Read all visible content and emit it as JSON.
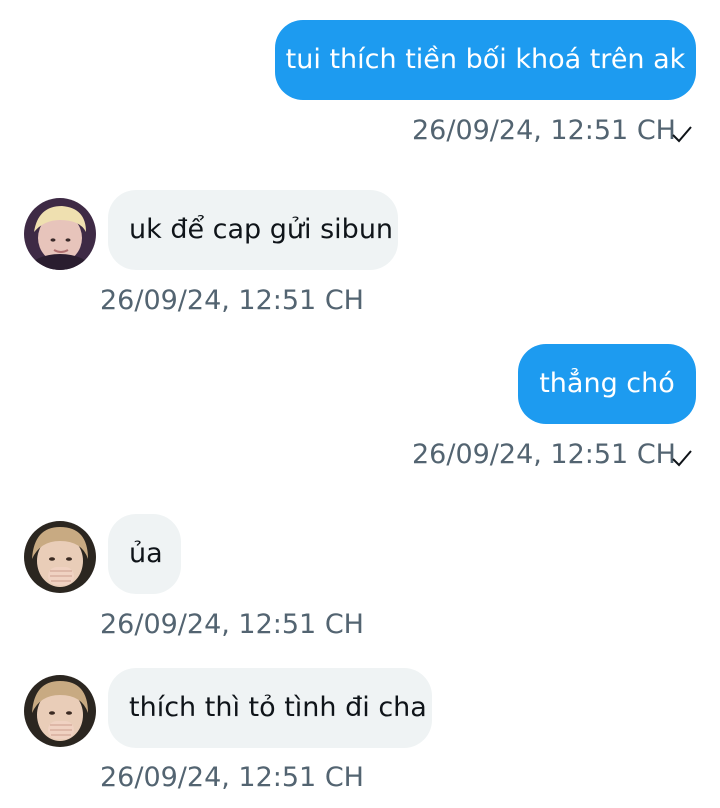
{
  "messages": [
    {
      "direction": "sent",
      "text": "tui thích tiền bối khoá trên ak",
      "time": "26/09/24, 12:51 CH",
      "read_icon": "check-icon"
    },
    {
      "direction": "received",
      "text": "uk để cap gửi sibun",
      "time": "26/09/24, 12:51 CH",
      "avatar_icon": "avatar-blonde"
    },
    {
      "direction": "sent",
      "text": "thẳng chó",
      "time": "26/09/24, 12:51 CH",
      "read_icon": "check-icon"
    },
    {
      "direction": "received",
      "text": "ủa",
      "time": "26/09/24, 12:51 CH",
      "avatar_icon": "avatar-hand-covering-mouth"
    },
    {
      "direction": "received",
      "text": "thích thì tỏ tình đi cha",
      "time": "26/09/24, 12:51 CH",
      "avatar_icon": "avatar-hand-covering-mouth"
    }
  ],
  "colors": {
    "sent_bubble": "#1d9bf0",
    "received_bubble": "#eff3f4",
    "timestamp": "#536471"
  }
}
